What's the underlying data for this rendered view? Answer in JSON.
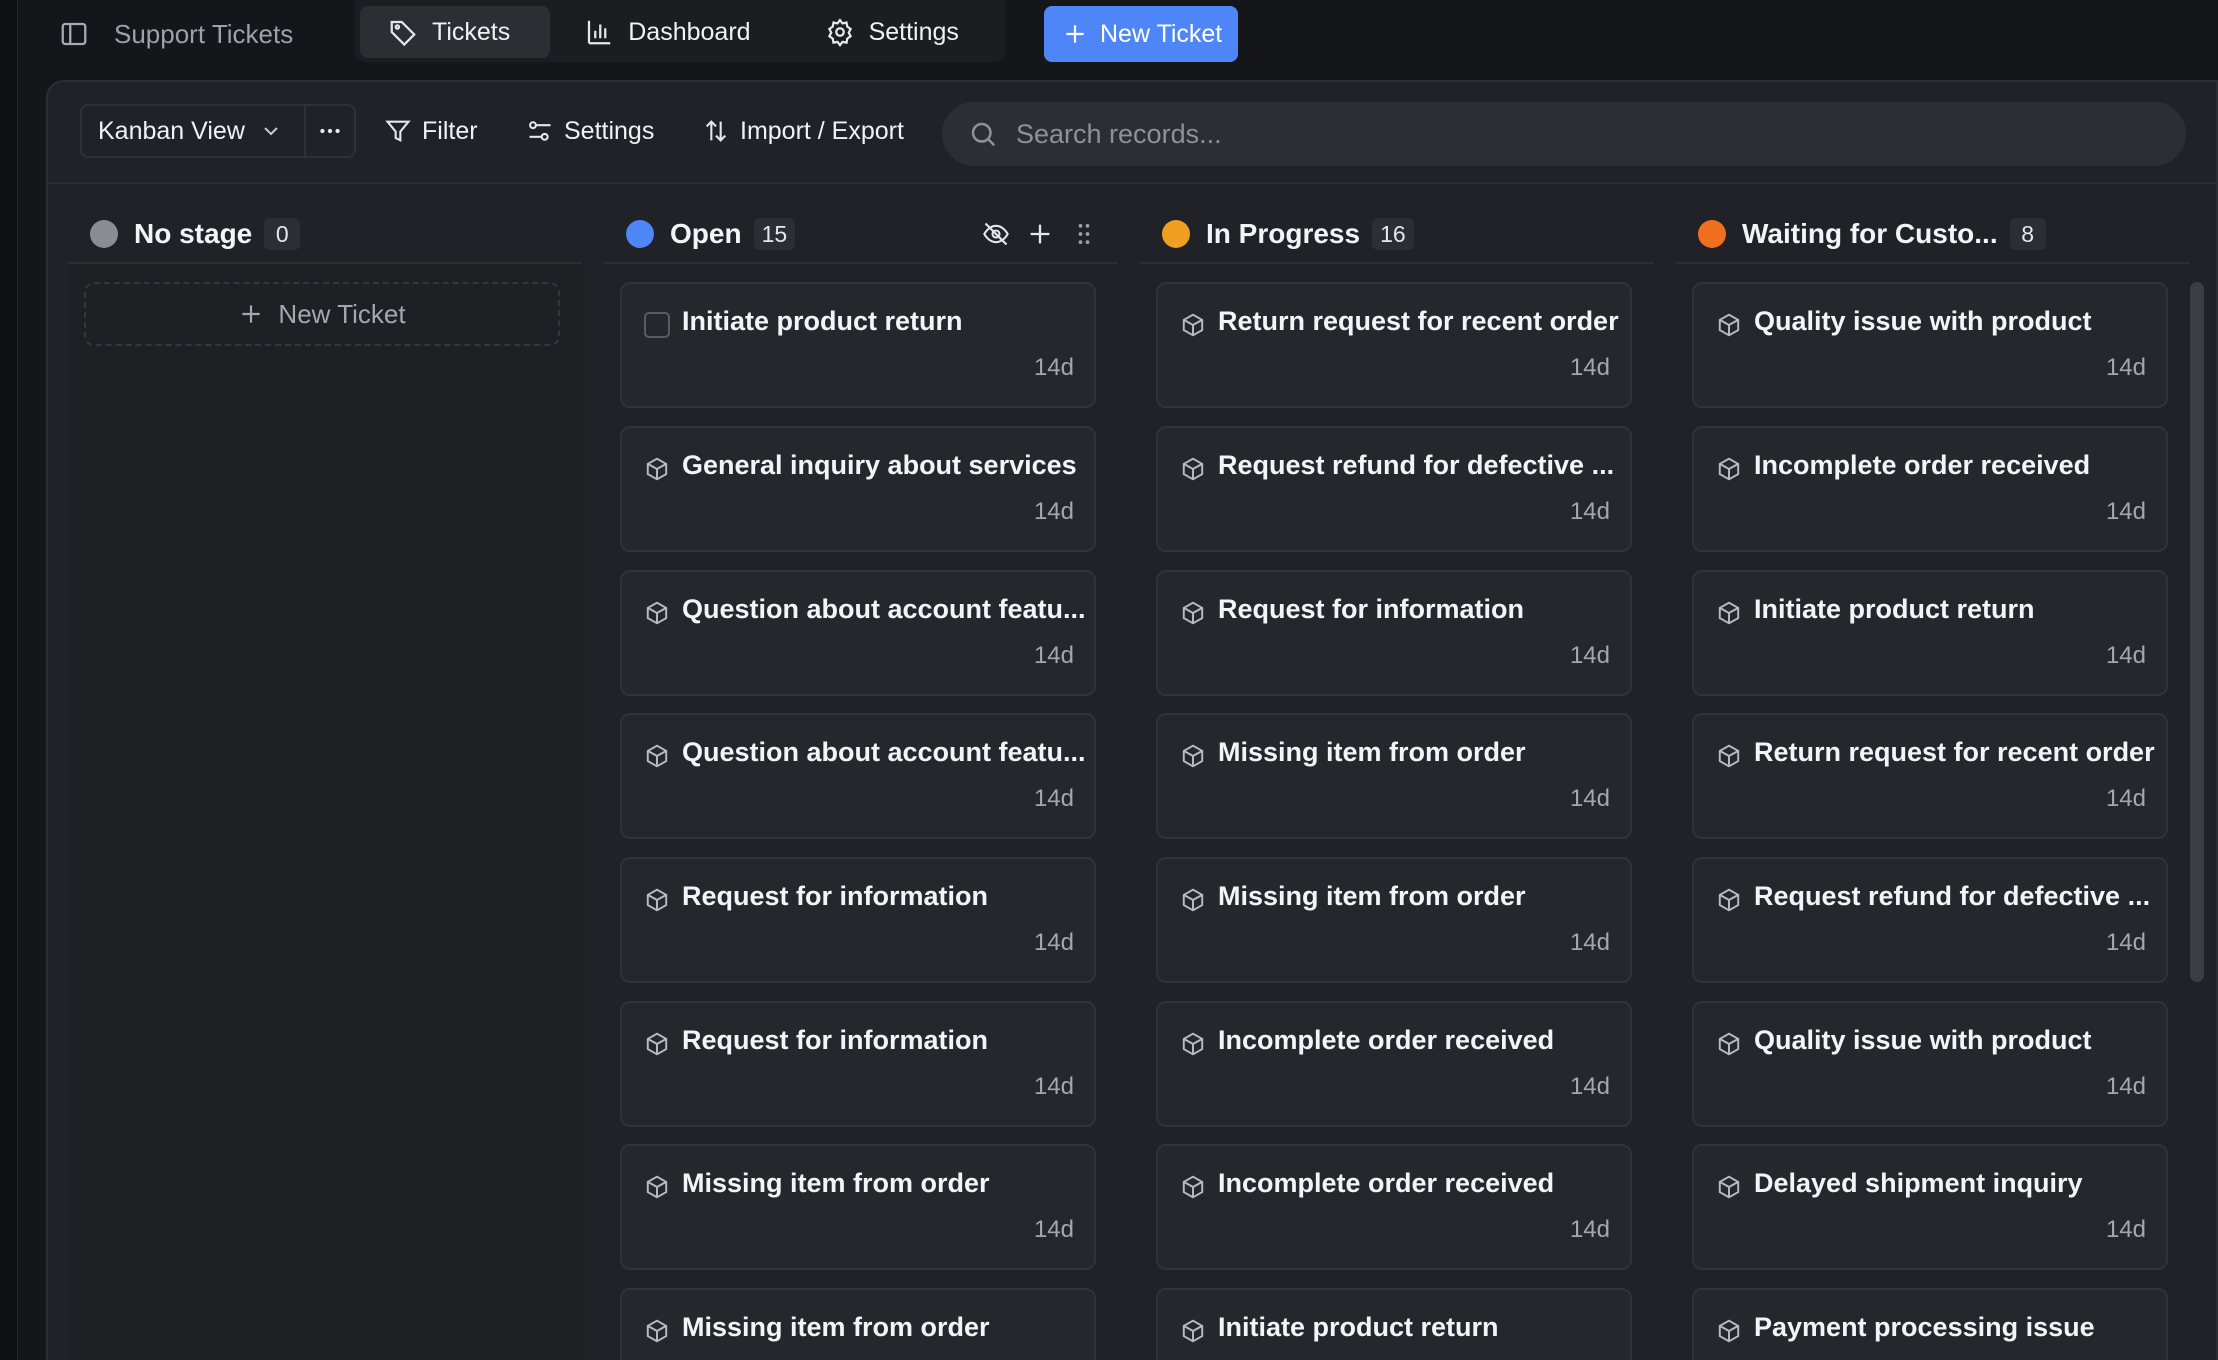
{
  "header": {
    "app_title": "Support Tickets",
    "tabs": [
      {
        "label": "Tickets",
        "icon": "tag-icon",
        "active": true
      },
      {
        "label": "Dashboard",
        "icon": "bar-chart-icon",
        "active": false
      },
      {
        "label": "Settings",
        "icon": "gear-icon",
        "active": false
      }
    ],
    "new_ticket_label": "New Ticket"
  },
  "toolbar": {
    "view_label": "Kanban View",
    "filter_label": "Filter",
    "settings_label": "Settings",
    "import_export_label": "Import / Export",
    "search_placeholder": "Search records..."
  },
  "colors": {
    "accent": "#4f86f7",
    "no_stage": "#8a8d94",
    "open": "#4f86f7",
    "in_progress": "#f0a020",
    "waiting": "#f07020"
  },
  "columns": [
    {
      "name": "No stage",
      "count": "0",
      "color": "#8a8d94",
      "add_label": "New Ticket",
      "cards": []
    },
    {
      "name": "Open",
      "count": "15",
      "color": "#4f86f7",
      "cards": [
        {
          "title": "Initiate product return",
          "age": "14d",
          "checkbox": true
        },
        {
          "title": "General inquiry about services",
          "age": "14d"
        },
        {
          "title": "Question about account featu...",
          "age": "14d"
        },
        {
          "title": "Question about account featu...",
          "age": "14d"
        },
        {
          "title": "Request for information",
          "age": "14d"
        },
        {
          "title": "Request for information",
          "age": "14d"
        },
        {
          "title": "Missing item from order",
          "age": "14d"
        },
        {
          "title": "Missing item from order",
          "age": ""
        }
      ]
    },
    {
      "name": "In Progress",
      "count": "16",
      "color": "#f0a020",
      "cards": [
        {
          "title": "Return request for recent order",
          "age": "14d"
        },
        {
          "title": "Request refund for defective ...",
          "age": "14d"
        },
        {
          "title": "Request for information",
          "age": "14d"
        },
        {
          "title": "Missing item from order",
          "age": "14d"
        },
        {
          "title": "Missing item from order",
          "age": "14d"
        },
        {
          "title": "Incomplete order received",
          "age": "14d"
        },
        {
          "title": "Incomplete order received",
          "age": "14d"
        },
        {
          "title": "Initiate product return",
          "age": ""
        }
      ]
    },
    {
      "name": "Waiting for Custo...",
      "count": "8",
      "color": "#f07020",
      "cards": [
        {
          "title": "Quality issue with product",
          "age": "14d"
        },
        {
          "title": "Incomplete order received",
          "age": "14d"
        },
        {
          "title": "Initiate product return",
          "age": "14d"
        },
        {
          "title": "Return request for recent order",
          "age": "14d"
        },
        {
          "title": "Request refund for defective ...",
          "age": "14d"
        },
        {
          "title": "Quality issue with product",
          "age": "14d"
        },
        {
          "title": "Delayed shipment inquiry",
          "age": "14d"
        },
        {
          "title": "Payment processing issue",
          "age": ""
        }
      ]
    }
  ]
}
